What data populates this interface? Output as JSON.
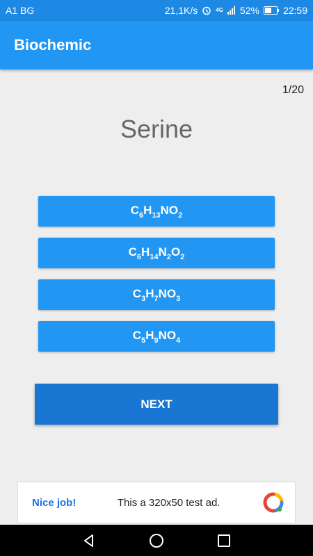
{
  "status_bar": {
    "carrier": "A1 BG",
    "speed": "21,1K/s",
    "network": "4G",
    "battery": "52%",
    "time": "22:59"
  },
  "app_bar": {
    "title": "Biochemic"
  },
  "quiz": {
    "counter": "1/20",
    "question": "Serine",
    "options": [
      [
        [
          "C",
          ""
        ],
        [
          "H",
          "6"
        ],
        [
          "NO",
          "13"
        ],
        [
          "",
          "2"
        ]
      ],
      [
        [
          "C",
          ""
        ],
        [
          "H",
          "6"
        ],
        [
          "N",
          "14"
        ],
        [
          "O",
          "2"
        ],
        [
          "",
          "2"
        ]
      ],
      [
        [
          "C",
          ""
        ],
        [
          "H",
          "3"
        ],
        [
          "NO",
          "7"
        ],
        [
          "",
          "3"
        ]
      ],
      [
        [
          "C",
          ""
        ],
        [
          "H",
          "5"
        ],
        [
          "NO",
          "9"
        ],
        [
          "",
          "4"
        ]
      ]
    ],
    "option_labels": [
      "C6H13NO2",
      "C6H14N2O2",
      "C3H7NO3",
      "C5H9NO4"
    ],
    "next_label": "NEXT"
  },
  "ad": {
    "headline": "Nice job!",
    "text": "This a 320x50 test ad."
  },
  "colors": {
    "status_bar": "#1e88e5",
    "app_bar": "#2196f3",
    "option": "#2196f3",
    "next": "#1976d2",
    "background": "#eeeeee"
  },
  "icons": {
    "status": [
      "alarm-icon",
      "signal-icon",
      "battery-icon"
    ],
    "nav": [
      "back-icon",
      "home-icon",
      "recents-icon"
    ]
  }
}
